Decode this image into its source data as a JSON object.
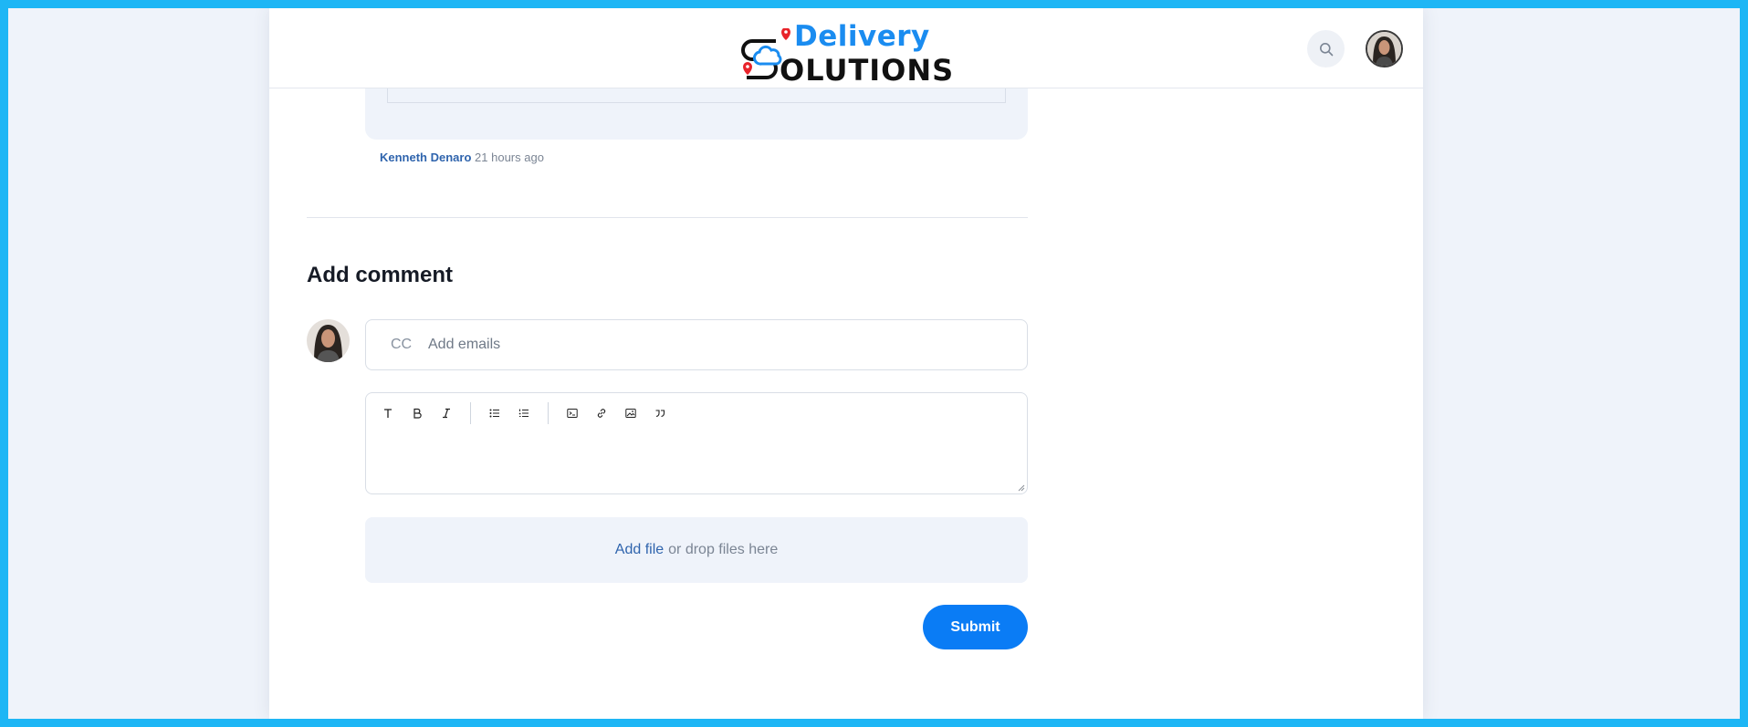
{
  "header": {
    "logo": {
      "line1": "Delivery",
      "line2": "OLUTIONS"
    },
    "search_icon": "search-icon",
    "avatar": "user-avatar"
  },
  "previous_comment": {
    "author": "Kenneth Denaro",
    "time": "21 hours ago"
  },
  "add_comment": {
    "title": "Add comment",
    "cc_label": "CC",
    "cc_placeholder": "Add emails",
    "toolbar": [
      {
        "name": "text-style-icon",
        "glyph": "T"
      },
      {
        "name": "bold-icon",
        "glyph": "B"
      },
      {
        "name": "italic-icon",
        "glyph": "I"
      },
      {
        "name": "bullet-list-icon"
      },
      {
        "name": "numbered-list-icon"
      },
      {
        "name": "code-block-icon"
      },
      {
        "name": "link-icon"
      },
      {
        "name": "image-icon"
      },
      {
        "name": "quote-icon"
      }
    ],
    "dropzone": {
      "link": "Add file",
      "text": "or drop files here"
    },
    "submit_label": "Submit"
  },
  "colors": {
    "accent": "#0a7cf5",
    "link": "#2f64ad",
    "frame": "#1eb6f5",
    "panel": "#eff3fa"
  }
}
